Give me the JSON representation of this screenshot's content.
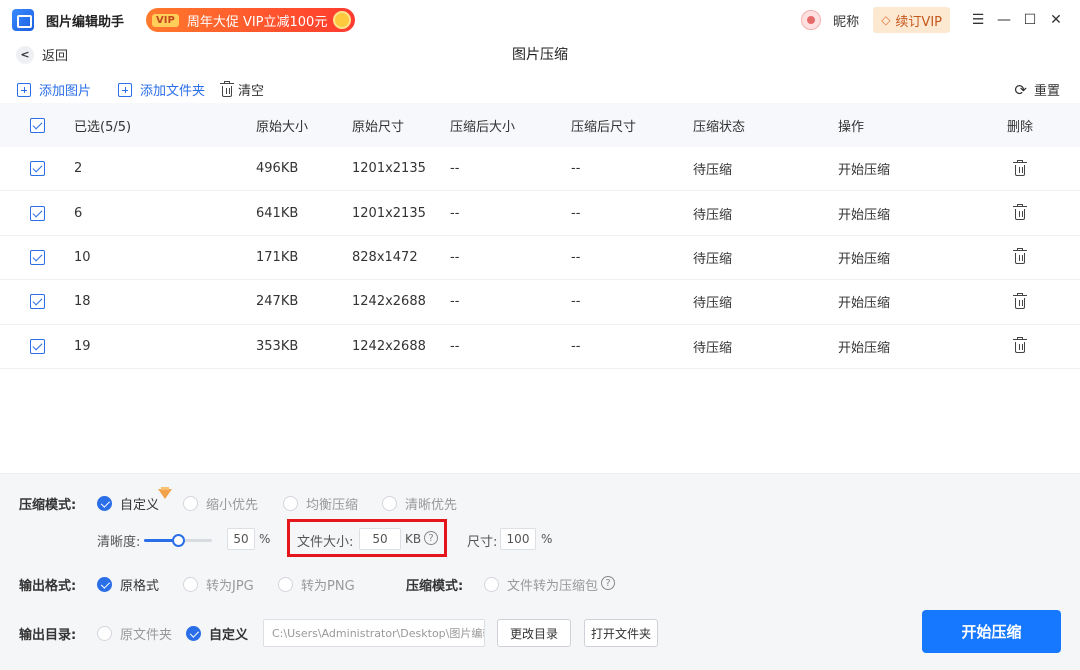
{
  "app": {
    "name": "图片编辑助手",
    "promo_tag": "VIP",
    "promo_text": "周年大促 VIP立减100元",
    "nickname": "昵称",
    "vip_button": "续订VIP",
    "win_menu": "☰",
    "win_min": "—",
    "win_max": "☐",
    "win_close": "✕"
  },
  "nav": {
    "back_label": "返回",
    "title": "图片压缩"
  },
  "toolbar": {
    "add_image": "添加图片",
    "add_folder": "添加文件夹",
    "clear": "清空",
    "reset": "重置"
  },
  "table": {
    "headers": {
      "selected": "已选(5/5)",
      "orig_size": "原始大小",
      "orig_dim": "原始尺寸",
      "comp_size": "压缩后大小",
      "comp_dim": "压缩后尺寸",
      "status": "压缩状态",
      "action": "操作",
      "delete": "删除"
    },
    "rows": [
      {
        "name": "2",
        "orig_size": "496KB",
        "orig_dim": "1201x2135",
        "comp_size": "--",
        "comp_dim": "--",
        "status": "待压缩",
        "action": "开始压缩"
      },
      {
        "name": "6",
        "orig_size": "641KB",
        "orig_dim": "1201x2135",
        "comp_size": "--",
        "comp_dim": "--",
        "status": "待压缩",
        "action": "开始压缩"
      },
      {
        "name": "10",
        "orig_size": "171KB",
        "orig_dim": "828x1472",
        "comp_size": "--",
        "comp_dim": "--",
        "status": "待压缩",
        "action": "开始压缩"
      },
      {
        "name": "18",
        "orig_size": "247KB",
        "orig_dim": "1242x2688",
        "comp_size": "--",
        "comp_dim": "--",
        "status": "待压缩",
        "action": "开始压缩"
      },
      {
        "name": "19",
        "orig_size": "353KB",
        "orig_dim": "1242x2688",
        "comp_size": "--",
        "comp_dim": "--",
        "status": "待压缩",
        "action": "开始压缩"
      }
    ]
  },
  "settings": {
    "mode_label": "压缩模式:",
    "modes": [
      "自定义",
      "缩小优先",
      "均衡压缩",
      "清晰优先"
    ],
    "clarity_label": "清晰度:",
    "clarity_value": "50",
    "clarity_unit": "%",
    "clarity_fraction": 0.5,
    "filesize_label": "文件大小:",
    "filesize_value": "50",
    "filesize_unit": "KB",
    "help_glyph": "?",
    "dim_label": "尺寸:",
    "dim_value": "100",
    "dim_unit": "%",
    "format_label": "输出格式:",
    "formats": [
      "原格式",
      "转为JPG",
      "转为PNG"
    ],
    "pack_label": "压缩模式:",
    "pack_option": "文件转为压缩包",
    "dir_label": "输出目录:",
    "dir_options": [
      "原文件夹",
      "自定义"
    ],
    "dir_path": "C:\\Users\\Administrator\\Desktop\\图片编辑",
    "change_dir": "更改目录",
    "open_folder": "打开文件夹",
    "start_button": "开始压缩"
  },
  "colors": {
    "accent": "#1677ff",
    "highlight": "#e4161c",
    "promo": "#ff3b2f"
  }
}
